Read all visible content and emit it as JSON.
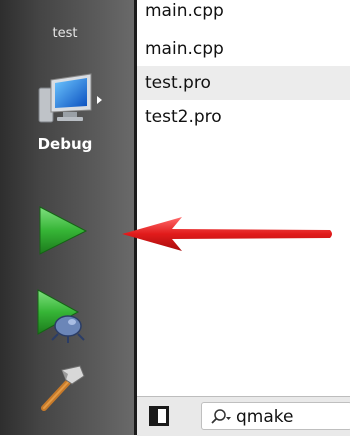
{
  "sidebar": {
    "kit_name": "test",
    "build_mode": "Debug",
    "icons": {
      "kit": "computer-monitor-icon",
      "run": "run-play-icon",
      "debug": "debug-bug-icon",
      "build": "build-hammer-icon"
    }
  },
  "file_list": {
    "items": [
      "main.cpp",
      "main.cpp",
      "test.pro",
      "test2.pro"
    ],
    "selected_index": 2
  },
  "locator": {
    "value": "qmake",
    "icon": "search-icon"
  },
  "annotation": {
    "arrow_color": "#e11b1b",
    "points_to": "run-button"
  },
  "colors": {
    "sidebar_dark": "#2e2e2e",
    "run_green": "#2ea32e",
    "selection": "#ececec"
  }
}
